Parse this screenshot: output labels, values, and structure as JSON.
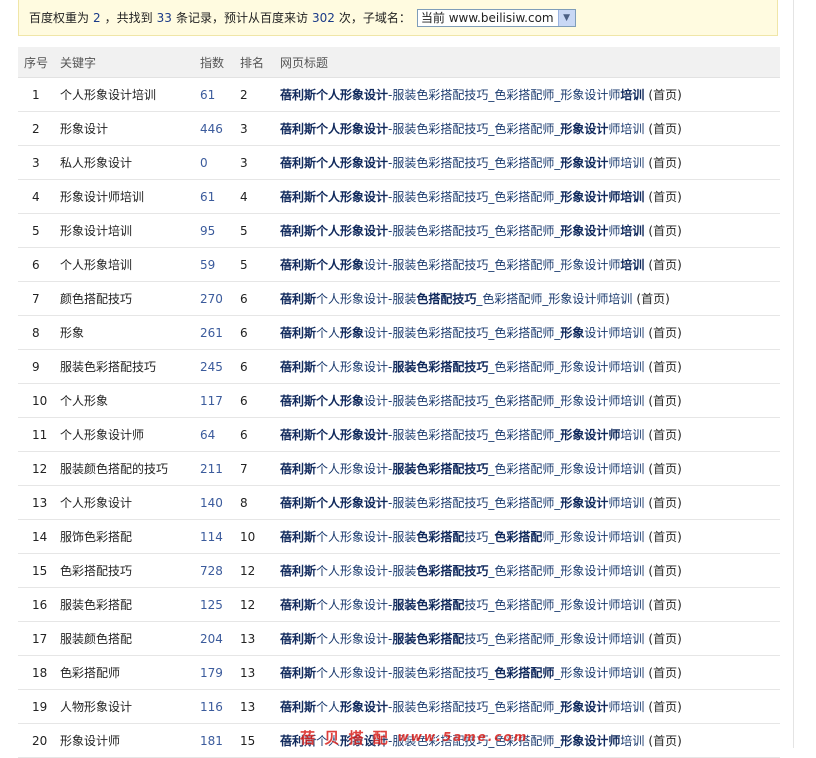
{
  "summary": {
    "part1": "百度权重为",
    "weight": "2",
    "part2": "，共找到",
    "records": "33",
    "part3": "条记录，预计从百度来访",
    "visits": "302",
    "part4": "次，子域名：",
    "subdomain_selected": "当前 www.beilisiw.com"
  },
  "table": {
    "headers": [
      "序号",
      "关键字",
      "指数",
      "排名",
      "网页标题"
    ],
    "home_label": "(首页)",
    "rows": [
      {
        "no": "1",
        "keyword": "个人形象设计培训",
        "index": "61",
        "rank": "2",
        "title": [
          [
            "蓓利斯",
            1
          ],
          [
            "个人形象设计",
            1
          ],
          [
            "-服装色彩搭配技巧_色彩搭配师_形象设计师",
            0
          ],
          [
            "培训",
            1
          ]
        ]
      },
      {
        "no": "2",
        "keyword": "形象设计",
        "index": "446",
        "rank": "3",
        "title": [
          [
            "蓓利斯个人",
            1
          ],
          [
            "形象设计",
            1
          ],
          [
            "-服装色彩搭配技巧_色彩搭配师_",
            0
          ],
          [
            "形象设计",
            1
          ],
          [
            "师培训",
            0
          ]
        ]
      },
      {
        "no": "3",
        "keyword": "私人形象设计",
        "index": "0",
        "rank": "3",
        "title": [
          [
            "蓓利斯个人",
            1
          ],
          [
            "形象设计",
            1
          ],
          [
            "-服装色彩搭配技巧_色彩搭配师_",
            0
          ],
          [
            "形象设计",
            1
          ],
          [
            "师培训",
            0
          ]
        ]
      },
      {
        "no": "4",
        "keyword": "形象设计师培训",
        "index": "61",
        "rank": "4",
        "title": [
          [
            "蓓利斯个人",
            1
          ],
          [
            "形象设计",
            1
          ],
          [
            "-服装色彩搭配技巧_色彩搭配师_",
            0
          ],
          [
            "形象设计师培训",
            1
          ]
        ]
      },
      {
        "no": "5",
        "keyword": "形象设计培训",
        "index": "95",
        "rank": "5",
        "title": [
          [
            "蓓利斯个人",
            1
          ],
          [
            "形象设计",
            1
          ],
          [
            "-服装色彩搭配技巧_色彩搭配师_",
            0
          ],
          [
            "形象设计",
            1
          ],
          [
            "师",
            0
          ],
          [
            "培训",
            1
          ]
        ]
      },
      {
        "no": "6",
        "keyword": "个人形象培训",
        "index": "59",
        "rank": "5",
        "title": [
          [
            "蓓利斯",
            1
          ],
          [
            "个人形象",
            1
          ],
          [
            "设计-服装色彩搭配技巧_色彩搭配师_形象设计师",
            0
          ],
          [
            "培训",
            1
          ]
        ]
      },
      {
        "no": "7",
        "keyword": "颜色搭配技巧",
        "index": "270",
        "rank": "6",
        "title": [
          [
            "蓓利斯",
            1
          ],
          [
            "个人形象设计-服装",
            0
          ],
          [
            "色搭配技巧",
            1
          ],
          [
            "_色彩搭配师_形象设计师培训",
            0
          ]
        ]
      },
      {
        "no": "8",
        "keyword": "形象",
        "index": "261",
        "rank": "6",
        "title": [
          [
            "蓓利斯",
            1
          ],
          [
            "个人",
            0
          ],
          [
            "形象",
            1
          ],
          [
            "设计-服装色彩搭配技巧_色彩搭配师_",
            0
          ],
          [
            "形象",
            1
          ],
          [
            "设计师培训",
            0
          ]
        ]
      },
      {
        "no": "9",
        "keyword": "服装色彩搭配技巧",
        "index": "245",
        "rank": "6",
        "title": [
          [
            "蓓利斯",
            1
          ],
          [
            "个人形象设计-",
            0
          ],
          [
            "服装色彩搭配技巧",
            1
          ],
          [
            "_色彩搭配师_形象设计师培训",
            0
          ]
        ]
      },
      {
        "no": "10",
        "keyword": "个人形象",
        "index": "117",
        "rank": "6",
        "title": [
          [
            "蓓利斯",
            1
          ],
          [
            "个人形象",
            1
          ],
          [
            "设计-服装色彩搭配技巧_色彩搭配师_形象设计师培训",
            0
          ]
        ]
      },
      {
        "no": "11",
        "keyword": "个人形象设计师",
        "index": "64",
        "rank": "6",
        "title": [
          [
            "蓓利斯",
            1
          ],
          [
            "个人形象设计",
            1
          ],
          [
            "-服装色彩搭配技巧_色彩搭配师_",
            0
          ],
          [
            "形象设计师",
            1
          ],
          [
            "培训",
            0
          ]
        ]
      },
      {
        "no": "12",
        "keyword": "服装颜色搭配的技巧",
        "index": "211",
        "rank": "7",
        "title": [
          [
            "蓓利斯",
            1
          ],
          [
            "个人形象设计-",
            0
          ],
          [
            "服装色彩搭配技巧",
            1
          ],
          [
            "_色彩搭配师_形象设计师培训",
            0
          ]
        ]
      },
      {
        "no": "13",
        "keyword": "个人形象设计",
        "index": "140",
        "rank": "8",
        "title": [
          [
            "蓓利斯",
            1
          ],
          [
            "个人形象设计",
            1
          ],
          [
            "-服装色彩搭配技巧_色彩搭配师_",
            0
          ],
          [
            "形象设计",
            1
          ],
          [
            "师培训",
            0
          ]
        ]
      },
      {
        "no": "14",
        "keyword": "服饰色彩搭配",
        "index": "114",
        "rank": "10",
        "title": [
          [
            "蓓利斯",
            1
          ],
          [
            "个人形象设计-服装",
            0
          ],
          [
            "色彩搭配",
            1
          ],
          [
            "技巧_",
            0
          ],
          [
            "色彩搭配",
            1
          ],
          [
            "师_形象设计师培训",
            0
          ]
        ]
      },
      {
        "no": "15",
        "keyword": "色彩搭配技巧",
        "index": "728",
        "rank": "12",
        "title": [
          [
            "蓓利斯",
            1
          ],
          [
            "个人形象设计-服装",
            0
          ],
          [
            "色彩搭配技巧",
            1
          ],
          [
            "_色彩搭配师_形象设计师培训",
            0
          ]
        ]
      },
      {
        "no": "16",
        "keyword": "服装色彩搭配",
        "index": "125",
        "rank": "12",
        "title": [
          [
            "蓓利斯",
            1
          ],
          [
            "个人形象设计-",
            0
          ],
          [
            "服装色彩搭配",
            1
          ],
          [
            "技巧_色彩搭配师_形象设计师培训",
            0
          ]
        ]
      },
      {
        "no": "17",
        "keyword": "服装颜色搭配",
        "index": "204",
        "rank": "13",
        "title": [
          [
            "蓓利斯",
            1
          ],
          [
            "个人形象设计-",
            0
          ],
          [
            "服装色彩搭配",
            1
          ],
          [
            "技巧_色彩搭配师_形象设计师培训",
            0
          ]
        ]
      },
      {
        "no": "18",
        "keyword": "色彩搭配师",
        "index": "179",
        "rank": "13",
        "title": [
          [
            "蓓利斯",
            1
          ],
          [
            "个人形象设计-服装色彩搭配技巧_",
            0
          ],
          [
            "色彩搭配师",
            1
          ],
          [
            "_形象设计师培训",
            0
          ]
        ]
      },
      {
        "no": "19",
        "keyword": "人物形象设计",
        "index": "116",
        "rank": "13",
        "title": [
          [
            "蓓利斯",
            1
          ],
          [
            "个人",
            0
          ],
          [
            "形象设计",
            1
          ],
          [
            "-服装色彩搭配技巧_色彩搭配师_",
            0
          ],
          [
            "形象设计",
            1
          ],
          [
            "师培训",
            0
          ]
        ]
      },
      {
        "no": "20",
        "keyword": "形象设计师",
        "index": "181",
        "rank": "15",
        "title": [
          [
            "蓓利斯",
            1
          ],
          [
            "个人",
            0
          ],
          [
            "形象设计",
            1
          ],
          [
            "-服装色彩搭配技巧_色彩搭配师_",
            0
          ],
          [
            "形象设计师",
            1
          ],
          [
            "培训",
            0
          ]
        ]
      }
    ]
  },
  "watermark": {
    "text": "蓓 贝 搭 配",
    "url": "www.5ame.com"
  }
}
